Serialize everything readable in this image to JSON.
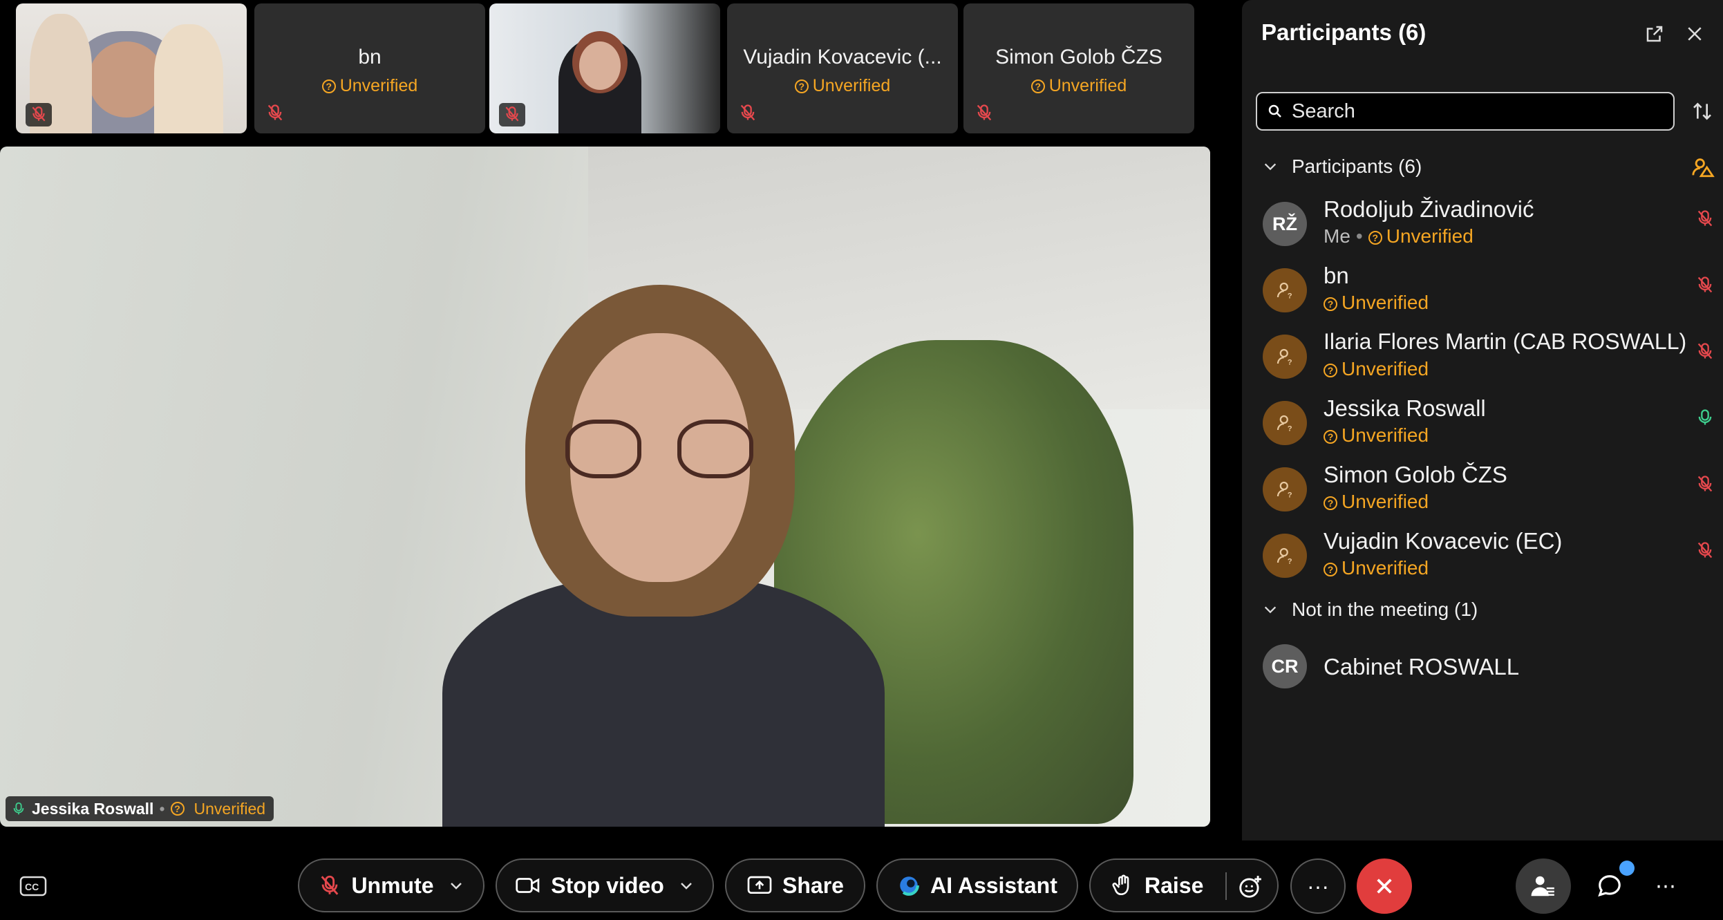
{
  "thumbnails": [
    {
      "name": "",
      "status": "",
      "has_video": true
    },
    {
      "name": "bn",
      "status": "Unverified",
      "has_video": false
    },
    {
      "name": "",
      "status": "",
      "has_video": true
    },
    {
      "name": "Vujadin Kovacevic (...",
      "status": "Unverified",
      "has_video": false
    },
    {
      "name": "Simon Golob ČZS",
      "status": "Unverified",
      "has_video": false
    }
  ],
  "main_video": {
    "speaker_name": "Jessika Roswall",
    "speaker_status": "Unverified"
  },
  "panel": {
    "title": "Participants (6)",
    "search_placeholder": "Search",
    "section_in_meeting": "Participants (6)",
    "section_not_in_meeting": "Not in the meeting (1)",
    "participants": [
      {
        "initials": "RŽ",
        "name": "Rodoljub Živadinović",
        "me_label": "Me",
        "status": "Unverified",
        "mic": "muted"
      },
      {
        "initials": "",
        "name": "bn",
        "status": "Unverified",
        "mic": "muted"
      },
      {
        "initials": "",
        "name": "Ilaria Flores Martin (CAB ROSWALL)",
        "status": "Unverified",
        "mic": "muted"
      },
      {
        "initials": "",
        "name": "Jessika Roswall",
        "status": "Unverified",
        "mic": "active"
      },
      {
        "initials": "",
        "name": "Simon Golob ČZS",
        "status": "Unverified",
        "mic": "muted"
      },
      {
        "initials": "",
        "name": "Vujadin Kovacevic (EC)",
        "status": "Unverified",
        "mic": "muted"
      }
    ],
    "not_in_meeting": [
      {
        "initials": "CR",
        "name": "Cabinet ROSWALL"
      }
    ]
  },
  "toolbar": {
    "unmute_label": "Unmute",
    "stop_video_label": "Stop video",
    "share_label": "Share",
    "ai_assistant_label": "AI Assistant",
    "raise_label": "Raise",
    "more_label": "···"
  },
  "colors": {
    "unverified": "#f5a623",
    "muted_mic": "#e5484d",
    "active_mic": "#3ecf8e",
    "end_call": "#e13d3d",
    "guest_avatar": "#7a4d19"
  }
}
